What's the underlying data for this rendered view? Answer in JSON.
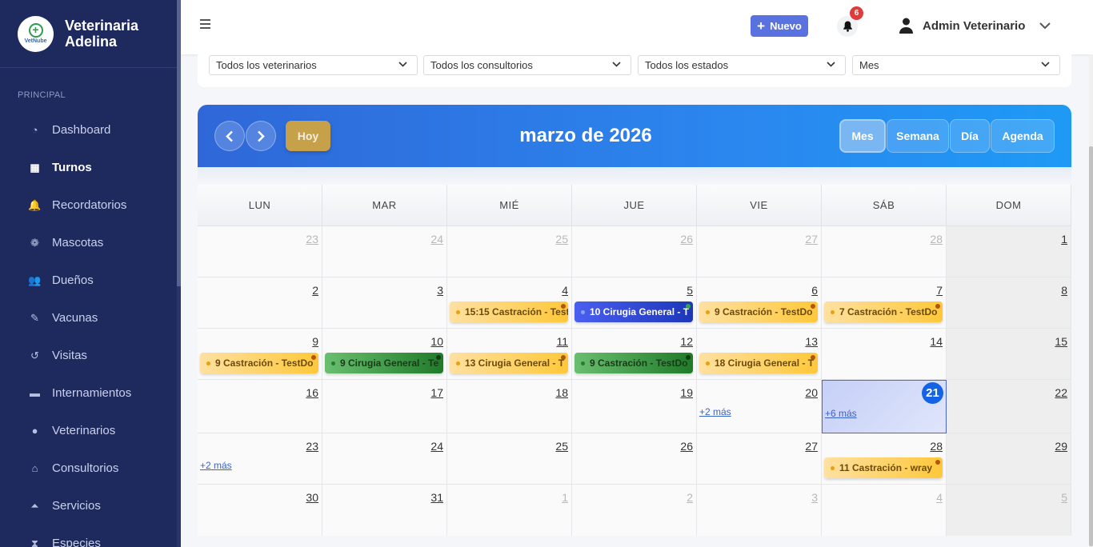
{
  "sidebar": {
    "brand": {
      "logo_text": "VetNube",
      "line1": "Veterinaria",
      "line2": "Adelina"
    },
    "section": "PRINCIPAL",
    "items": [
      {
        "label": "Dashboard",
        "icon": "dashboard-icon"
      },
      {
        "label": "Turnos",
        "icon": "calendar-icon",
        "active": true
      },
      {
        "label": "Recordatorios",
        "icon": "bell-icon"
      },
      {
        "label": "Mascotas",
        "icon": "paw-icon"
      },
      {
        "label": "Dueños",
        "icon": "users-icon"
      },
      {
        "label": "Vacunas",
        "icon": "syringe-icon"
      },
      {
        "label": "Visitas",
        "icon": "history-icon"
      },
      {
        "label": "Internamientos",
        "icon": "bed-icon"
      },
      {
        "label": "Veterinarios",
        "icon": "user-md-icon"
      },
      {
        "label": "Consultorios",
        "icon": "clinic-icon"
      },
      {
        "label": "Servicios",
        "icon": "bell-concierge-icon"
      },
      {
        "label": "Especies",
        "icon": "hourglass-icon"
      }
    ]
  },
  "topbar": {
    "new_label": "Nuevo",
    "notif_count": "6",
    "user_name": "Admin Veterinario"
  },
  "filters": {
    "vet": "Todos los veterinarios",
    "room": "Todos los consultorios",
    "state": "Todos los estados",
    "view": "Mes"
  },
  "calendar": {
    "today_label": "Hoy",
    "title": "marzo de 2026",
    "views": [
      "Mes",
      "Semana",
      "Día",
      "Agenda"
    ],
    "active_view": "Mes",
    "weekdays": [
      "LUN",
      "MAR",
      "MIÉ",
      "JUE",
      "VIE",
      "SÁB",
      "DOM"
    ],
    "weeks": [
      [
        {
          "d": "23",
          "o": true
        },
        {
          "d": "24",
          "o": true
        },
        {
          "d": "25",
          "o": true
        },
        {
          "d": "26",
          "o": true
        },
        {
          "d": "27",
          "o": true
        },
        {
          "d": "28",
          "o": true
        },
        {
          "d": "1"
        }
      ],
      [
        {
          "d": "2"
        },
        {
          "d": "3"
        },
        {
          "d": "4"
        },
        {
          "d": "5"
        },
        {
          "d": "6"
        },
        {
          "d": "7"
        },
        {
          "d": "8"
        }
      ],
      [
        {
          "d": "9"
        },
        {
          "d": "10"
        },
        {
          "d": "11"
        },
        {
          "d": "12"
        },
        {
          "d": "13"
        },
        {
          "d": "14"
        },
        {
          "d": "15"
        }
      ],
      [
        {
          "d": "16"
        },
        {
          "d": "17"
        },
        {
          "d": "18"
        },
        {
          "d": "19"
        },
        {
          "d": "20",
          "more": "+2 más"
        },
        {
          "d": "21",
          "today": true,
          "more": "+6 más"
        },
        {
          "d": "22"
        }
      ],
      [
        {
          "d": "23",
          "more": "+2 más"
        },
        {
          "d": "24"
        },
        {
          "d": "25"
        },
        {
          "d": "26"
        },
        {
          "d": "27"
        },
        {
          "d": "28"
        },
        {
          "d": "29"
        }
      ],
      [
        {
          "d": "30"
        },
        {
          "d": "31"
        },
        {
          "d": "1",
          "o": true
        },
        {
          "d": "2",
          "o": true
        },
        {
          "d": "3",
          "o": true
        },
        {
          "d": "4",
          "o": true
        },
        {
          "d": "5",
          "o": true
        }
      ]
    ],
    "events": [
      {
        "week": 1,
        "day": 2,
        "text": "15:15 Castración - Test",
        "color": "orange"
      },
      {
        "week": 1,
        "day": 3,
        "text": "10 Cirugia General - T",
        "color": "blue"
      },
      {
        "week": 1,
        "day": 4,
        "text": "9 Castración - TestDo",
        "color": "orange"
      },
      {
        "week": 1,
        "day": 5,
        "text": "7 Castración - TestDo",
        "color": "orange"
      },
      {
        "week": 2,
        "day": 0,
        "text": "9 Castración - TestDo",
        "color": "orange"
      },
      {
        "week": 2,
        "day": 1,
        "text": "9 Cirugia General - Te",
        "color": "green"
      },
      {
        "week": 2,
        "day": 2,
        "text": "13 Cirugia General - T",
        "color": "orange"
      },
      {
        "week": 2,
        "day": 3,
        "text": "9 Castración - TestDo",
        "color": "green"
      },
      {
        "week": 2,
        "day": 4,
        "text": "18 Cirugia General - T",
        "color": "orange"
      },
      {
        "week": 4,
        "day": 5,
        "text": "11 Castración - wray",
        "color": "orange"
      }
    ]
  }
}
